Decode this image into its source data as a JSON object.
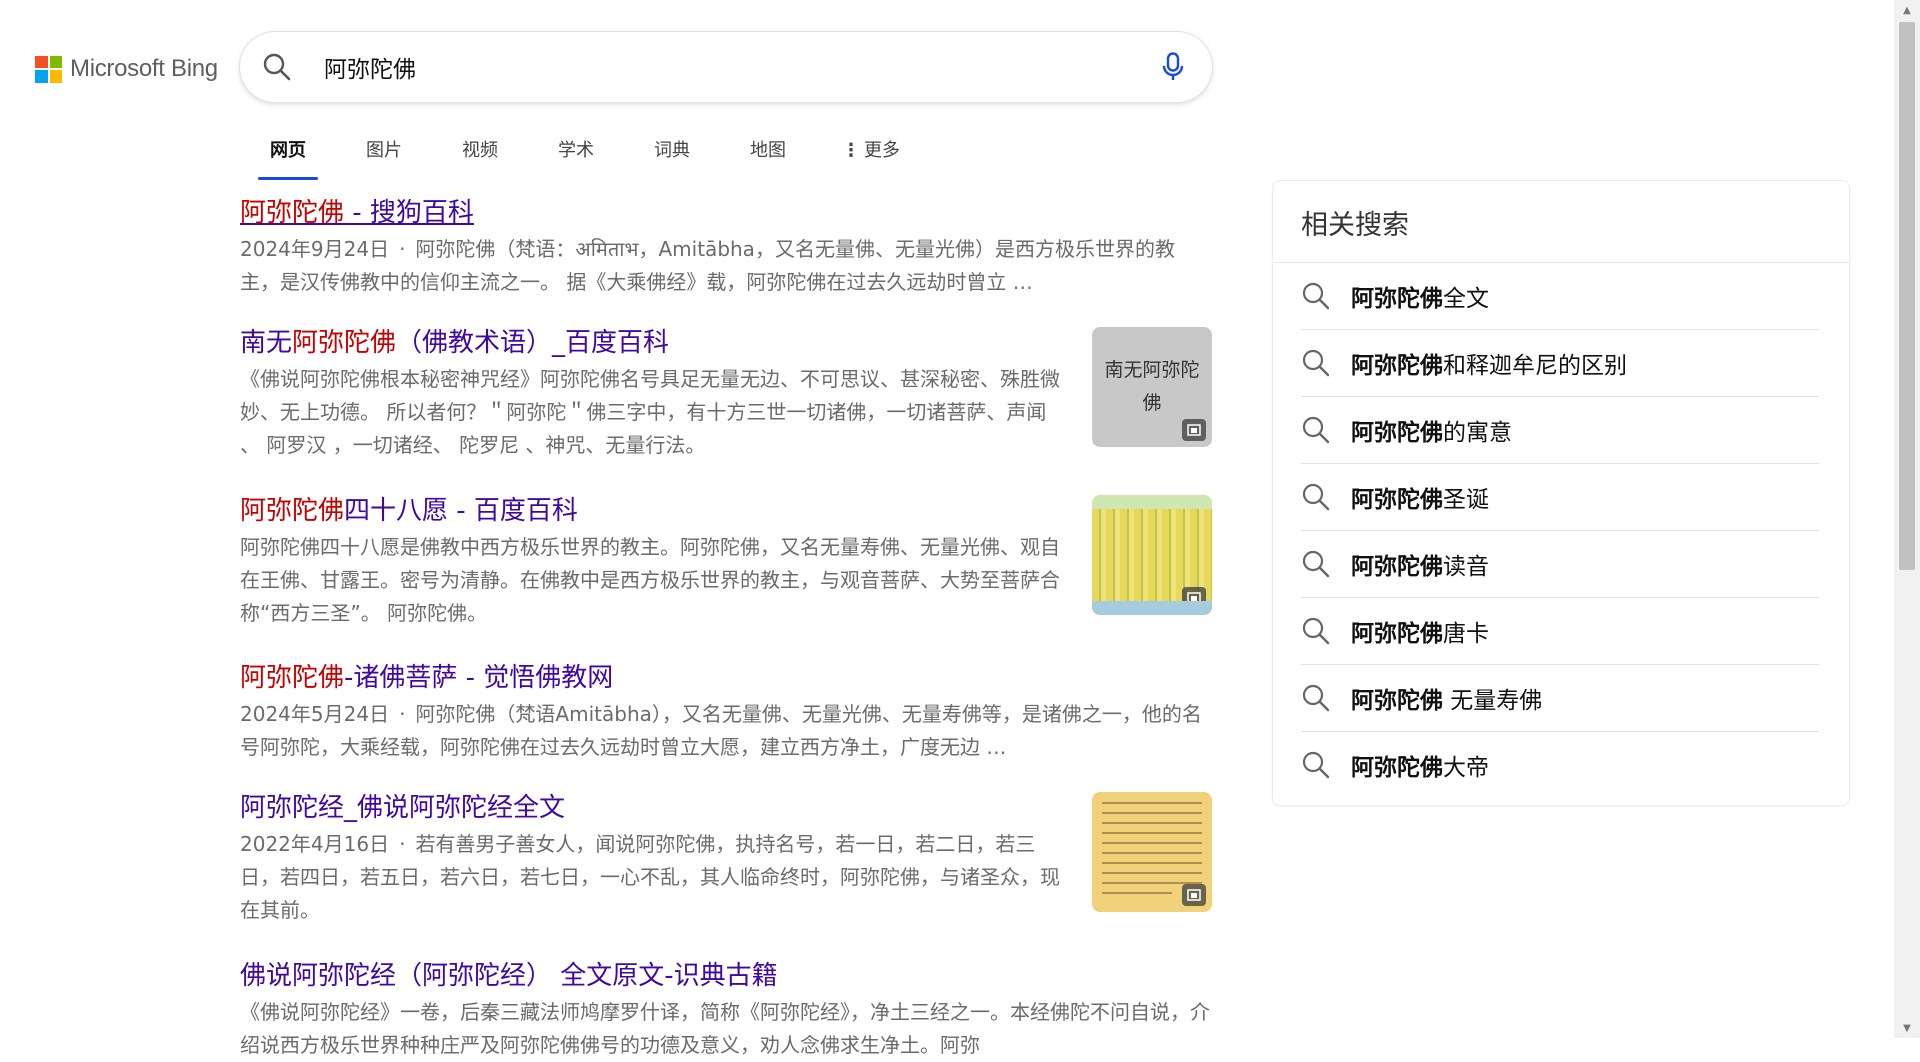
{
  "header": {
    "logo_text": "Microsoft Bing",
    "search_query": "阿弥陀佛"
  },
  "tabs": [
    {
      "label": "网页",
      "active": true
    },
    {
      "label": "图片"
    },
    {
      "label": "视频"
    },
    {
      "label": "学术"
    },
    {
      "label": "词典"
    },
    {
      "label": "地图"
    },
    {
      "label": "更多",
      "icon": "kebab-icon"
    }
  ],
  "results": [
    {
      "title_hl": "阿弥陀佛",
      "title_rest": " - 搜狗百科",
      "date": "2024年9月24日",
      "snippet": "阿弥陀佛（梵语：अमिताभ，Amitābha，又名无量佛、无量光佛）是西方极乐世界的教主，是汉传佛教中的信仰主流之一。 据《大乘佛经》载，阿弥陀佛在过去久远劫时曾立 …"
    },
    {
      "title_pre": "南无",
      "title_hl": "阿弥陀佛",
      "title_rest": "（佛教术语）_百度百科",
      "snippet": "《佛说阿弥陀佛根本秘密神咒经》阿弥陀佛名号具足无量无边、不可思议、甚深秘密、殊胜微妙、无上功德。 所以者何？＂阿弥陀＂佛三字中，有十方三世一切诸佛，一切诸菩萨、声闻 、 阿罗汉 ，一切诸经、 陀罗尼 、神咒、无量行法。",
      "thumb_text": "南无阿弥陀佛"
    },
    {
      "title_hl": "阿弥陀佛",
      "title_rest": "四十八愿 - 百度百科",
      "snippet": "阿弥陀佛四十八愿是佛教中西方极乐世界的教主。阿弥陀佛，又名无量寿佛、无量光佛、观自在王佛、甘露王。密号为清静。在佛教中是西方极乐世界的教主，与观音菩萨、大势至菩萨合称“西方三圣”。 阿弥陀佛。"
    },
    {
      "title_hl": "阿弥陀佛",
      "title_rest": "-诸佛菩萨 - 觉悟佛教网",
      "date": "2024年5月24日",
      "snippet": "阿弥陀佛（梵语Amitābha），又名无量佛、无量光佛、无量寿佛等，是诸佛之一，他的名号阿弥陀，大乘经载，阿弥陀佛在过去久远劫时曾立大愿，建立西方净土，广度无边 …"
    },
    {
      "title_rest": "阿弥陀经_佛说阿弥陀经全文",
      "date": "2022年4月16日",
      "snippet": "若有善男子善女人，闻说阿弥陀佛，执持名号，若一日，若二日，若三日，若四日，若五日，若六日，若七日，一心不乱，其人临命终时，阿弥陀佛，与诸圣众，现在其前。"
    },
    {
      "title_rest": "佛说阿弥陀经（阿弥陀经） 全文原文-识典古籍",
      "snippet": "《佛说阿弥陀经》一卷，后秦三藏法师鸠摩罗什译，简称《阿弥陀经》，净土三经之一。本经佛陀不问自说，介绍说西方极乐世界种种庄严及阿弥陀佛佛号的功德及意义，劝人念佛求生净土。阿弥"
    }
  ],
  "related": {
    "title": "相关搜索",
    "items": [
      {
        "bold": "阿弥陀佛",
        "rest": "全文"
      },
      {
        "bold": "阿弥陀佛",
        "rest": "和释迦牟尼的区别"
      },
      {
        "bold": "阿弥陀佛",
        "rest": "的寓意"
      },
      {
        "bold": "阿弥陀佛",
        "rest": "圣诞"
      },
      {
        "bold": "阿弥陀佛",
        "rest": "读音"
      },
      {
        "bold": "阿弥陀佛",
        "rest": "唐卡"
      },
      {
        "bold": "阿弥陀佛",
        "rest": " 无量寿佛"
      },
      {
        "bold": "阿弥陀佛",
        "rest": "大帝"
      }
    ]
  },
  "colors": {
    "link": "#4007a2",
    "highlight": "#c80000",
    "tab_indicator": "#174ae4",
    "mic": "#174ae4"
  }
}
